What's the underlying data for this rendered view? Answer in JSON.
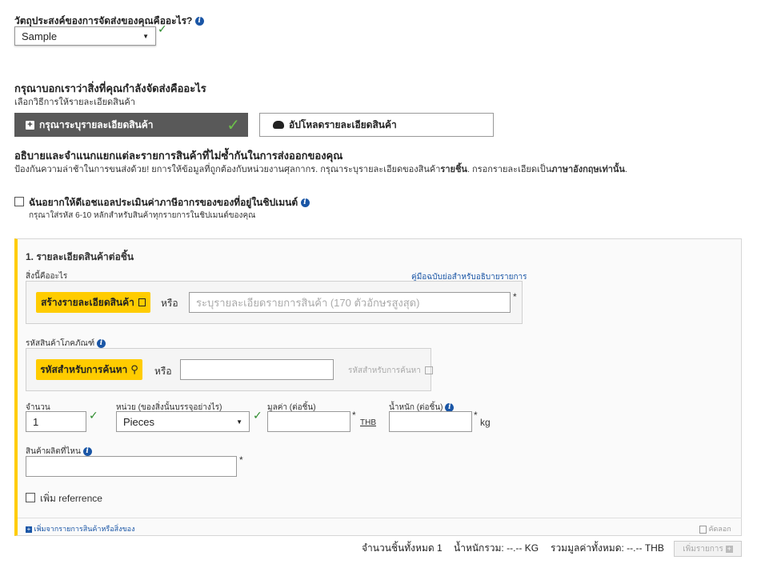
{
  "purpose": {
    "question": "วัตถุประสงค์ของการจัดส่งของคุณคืออะไร?",
    "selected": "Sample"
  },
  "shipping_what": {
    "heading": "กรุณาบอกเราว่าสิ่งที่คุณกำลังจัดส่งคืออะไร",
    "subheading": "เลือกวิธีการให้รายละเอียดสินค้า",
    "tab_enter_label": "กรุณาระบุรายละเอียดสินค้า",
    "tab_upload_label": "อัปโหลดรายละเอียดสินค้า"
  },
  "describe": {
    "heading": "อธิบายและจำแนกแยกแต่ละรายการสินค้าที่ไม่ซ้ำกันในการส่งออกของคุณ",
    "desc_1": "ป้องกันความล่าช้าในการขนส่งด้วย! ยการให้ข้อมูลที่ถูกต้องกับหน่วยงานศุลกากร. กรุณาระบุรายละเอียดของสินค้า",
    "desc_bold_1": "รายชิ้น",
    "desc_2": ". กรอกรายละเอียดเป็น",
    "desc_bold_2": "ภาษาอังกฤษเท่านั้น",
    "desc_3": "."
  },
  "duty_estimate": {
    "label": "ฉันอยากให้ดีเอชแอลประเมินค่าภาษีอากรของของที่อยู่ในชิปเมนต์",
    "hint": "กรุณาใส่รหัส 6-10 หลักสำหรับสินค้าทุกรายการในชิปเมนต์ของคุณ"
  },
  "item": {
    "title": "1. รายละเอียดสินค้าต่อชิ้น",
    "what_label": "สิ่งนี้คืออะไร",
    "guide_link": "คู่มือฉบับย่อสำหรับอธิบายรายการ",
    "create_btn": "สร้างรายละเอียดสินค้า",
    "or_1": "หรือ",
    "desc_placeholder": "ระบุรายละเอียดรายการสินค้า (170 ตัวอักษรสูงสุด)",
    "required": "*",
    "code_label": "รหัสสินค้าโภคภัณฑ์",
    "search_code_btn": "รหัสสำหรับการค้นหา",
    "or_2": "หรือ",
    "code_search_link": "รหัสสำหรับการค้นหา",
    "qty_label": "จำนวน",
    "qty_value": "1",
    "unit_label": "หน่วย (ของสิ่งนั้นบรรจุอย่างไร)",
    "unit_value": "Pieces",
    "value_label": "มูลค่า (ต่อชิ้น)",
    "currency": "THB",
    "weight_label": "น้ำหนัก (ต่อชิ้น)",
    "weight_unit": "kg",
    "origin_label": "สินค้าผลิตที่ไหน",
    "add_ref_label": "เพิ่ม referrence",
    "add_from_list": "เพิ่มจากรายการสินค้าหรือสิ่งของ",
    "copy_label": "คัดลอก"
  },
  "summary": {
    "total_pieces": "จำนวนชิ้นทั้งหมด 1",
    "total_weight": "น้ำหนักรวม: --.-- KG",
    "total_value": "รวมมูลค่าทั้งหมด: --.-- THB",
    "add_item_btn": "เพิ่มรายการ"
  }
}
